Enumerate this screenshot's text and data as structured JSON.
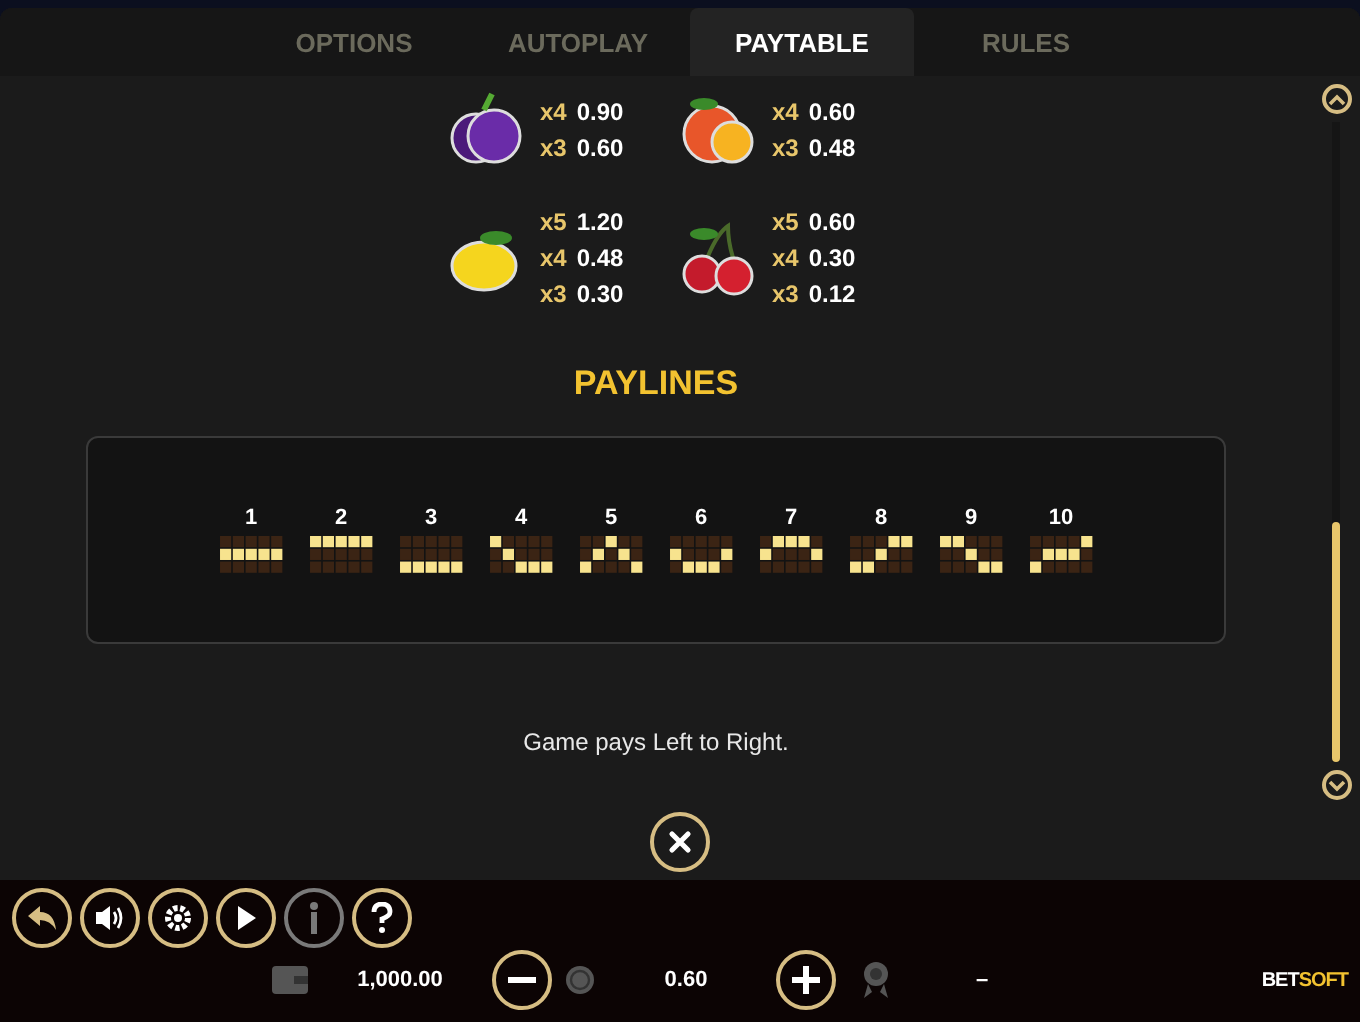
{
  "tabs": [
    {
      "label": "OPTIONS",
      "selected": false
    },
    {
      "label": "AUTOPLAY",
      "selected": false
    },
    {
      "label": "PAYTABLE",
      "selected": true
    },
    {
      "label": "RULES",
      "selected": false
    }
  ],
  "symbols": [
    {
      "pays": [
        {
          "count": "x4",
          "value": "0.90"
        },
        {
          "count": "x3",
          "value": "0.60"
        }
      ]
    },
    {
      "pays": [
        {
          "count": "x4",
          "value": "0.60"
        },
        {
          "count": "x3",
          "value": "0.48"
        }
      ]
    },
    {
      "pays": [
        {
          "count": "x5",
          "value": "1.20"
        },
        {
          "count": "x4",
          "value": "0.48"
        },
        {
          "count": "x3",
          "value": "0.30"
        }
      ]
    },
    {
      "pays": [
        {
          "count": "x5",
          "value": "0.60"
        },
        {
          "count": "x4",
          "value": "0.30"
        },
        {
          "count": "x3",
          "value": "0.12"
        }
      ]
    }
  ],
  "paylines_title": "PAYLINES",
  "paylines": [
    {
      "number": "1",
      "rows": [
        [
          {
            "lit": false
          },
          {
            "lit": false
          },
          {
            "lit": false
          },
          {
            "lit": false
          },
          {
            "lit": false
          }
        ],
        [
          {
            "lit": true
          },
          {
            "lit": true
          },
          {
            "lit": true
          },
          {
            "lit": true
          },
          {
            "lit": true
          }
        ],
        [
          {
            "lit": false
          },
          {
            "lit": false
          },
          {
            "lit": false
          },
          {
            "lit": false
          },
          {
            "lit": false
          }
        ]
      ]
    },
    {
      "number": "2",
      "rows": [
        [
          {
            "lit": true
          },
          {
            "lit": true
          },
          {
            "lit": true
          },
          {
            "lit": true
          },
          {
            "lit": true
          }
        ],
        [
          {
            "lit": false
          },
          {
            "lit": false
          },
          {
            "lit": false
          },
          {
            "lit": false
          },
          {
            "lit": false
          }
        ],
        [
          {
            "lit": false
          },
          {
            "lit": false
          },
          {
            "lit": false
          },
          {
            "lit": false
          },
          {
            "lit": false
          }
        ]
      ]
    },
    {
      "number": "3",
      "rows": [
        [
          {
            "lit": false
          },
          {
            "lit": false
          },
          {
            "lit": false
          },
          {
            "lit": false
          },
          {
            "lit": false
          }
        ],
        [
          {
            "lit": false
          },
          {
            "lit": false
          },
          {
            "lit": false
          },
          {
            "lit": false
          },
          {
            "lit": false
          }
        ],
        [
          {
            "lit": true
          },
          {
            "lit": true
          },
          {
            "lit": true
          },
          {
            "lit": true
          },
          {
            "lit": true
          }
        ]
      ]
    },
    {
      "number": "4",
      "rows": [
        [
          {
            "lit": true
          },
          {
            "lit": false
          },
          {
            "lit": false
          },
          {
            "lit": false
          },
          {
            "lit": false
          }
        ],
        [
          {
            "lit": false
          },
          {
            "lit": true
          },
          {
            "lit": false
          },
          {
            "lit": false
          },
          {
            "lit": false
          }
        ],
        [
          {
            "lit": false
          },
          {
            "lit": false
          },
          {
            "lit": true
          },
          {
            "lit": true
          },
          {
            "lit": true
          }
        ]
      ]
    },
    {
      "number": "5",
      "rows": [
        [
          {
            "lit": false
          },
          {
            "lit": false
          },
          {
            "lit": true
          },
          {
            "lit": false
          },
          {
            "lit": false
          }
        ],
        [
          {
            "lit": false
          },
          {
            "lit": true
          },
          {
            "lit": false
          },
          {
            "lit": true
          },
          {
            "lit": false
          }
        ],
        [
          {
            "lit": true
          },
          {
            "lit": false
          },
          {
            "lit": false
          },
          {
            "lit": false
          },
          {
            "lit": true
          }
        ]
      ]
    },
    {
      "number": "6",
      "rows": [
        [
          {
            "lit": false
          },
          {
            "lit": false
          },
          {
            "lit": false
          },
          {
            "lit": false
          },
          {
            "lit": false
          }
        ],
        [
          {
            "lit": true
          },
          {
            "lit": false
          },
          {
            "lit": false
          },
          {
            "lit": false
          },
          {
            "lit": true
          }
        ],
        [
          {
            "lit": false
          },
          {
            "lit": true
          },
          {
            "lit": true
          },
          {
            "lit": true
          },
          {
            "lit": false
          }
        ]
      ]
    },
    {
      "number": "7",
      "rows": [
        [
          {
            "lit": false
          },
          {
            "lit": true
          },
          {
            "lit": true
          },
          {
            "lit": true
          },
          {
            "lit": false
          }
        ],
        [
          {
            "lit": true
          },
          {
            "lit": false
          },
          {
            "lit": false
          },
          {
            "lit": false
          },
          {
            "lit": true
          }
        ],
        [
          {
            "lit": false
          },
          {
            "lit": false
          },
          {
            "lit": false
          },
          {
            "lit": false
          },
          {
            "lit": false
          }
        ]
      ]
    },
    {
      "number": "8",
      "rows": [
        [
          {
            "lit": false
          },
          {
            "lit": false
          },
          {
            "lit": false
          },
          {
            "lit": true
          },
          {
            "lit": true
          }
        ],
        [
          {
            "lit": false
          },
          {
            "lit": false
          },
          {
            "lit": true
          },
          {
            "lit": false
          },
          {
            "lit": false
          }
        ],
        [
          {
            "lit": true
          },
          {
            "lit": true
          },
          {
            "lit": false
          },
          {
            "lit": false
          },
          {
            "lit": false
          }
        ]
      ]
    },
    {
      "number": "9",
      "rows": [
        [
          {
            "lit": true
          },
          {
            "lit": true
          },
          {
            "lit": false
          },
          {
            "lit": false
          },
          {
            "lit": false
          }
        ],
        [
          {
            "lit": false
          },
          {
            "lit": false
          },
          {
            "lit": true
          },
          {
            "lit": false
          },
          {
            "lit": false
          }
        ],
        [
          {
            "lit": false
          },
          {
            "lit": false
          },
          {
            "lit": false
          },
          {
            "lit": true
          },
          {
            "lit": true
          }
        ]
      ]
    },
    {
      "number": "10",
      "rows": [
        [
          {
            "lit": false
          },
          {
            "lit": false
          },
          {
            "lit": false
          },
          {
            "lit": false
          },
          {
            "lit": true
          }
        ],
        [
          {
            "lit": false
          },
          {
            "lit": true
          },
          {
            "lit": true
          },
          {
            "lit": true
          },
          {
            "lit": false
          }
        ],
        [
          {
            "lit": true
          },
          {
            "lit": false
          },
          {
            "lit": false
          },
          {
            "lit": false
          },
          {
            "lit": false
          }
        ]
      ]
    }
  ],
  "note": "Game pays Left to Right.",
  "bottom_bar": {
    "balance": "1,000.00",
    "bet": "0.60",
    "win": "–",
    "brand_left": "BET",
    "brand_right": "SOFT"
  }
}
